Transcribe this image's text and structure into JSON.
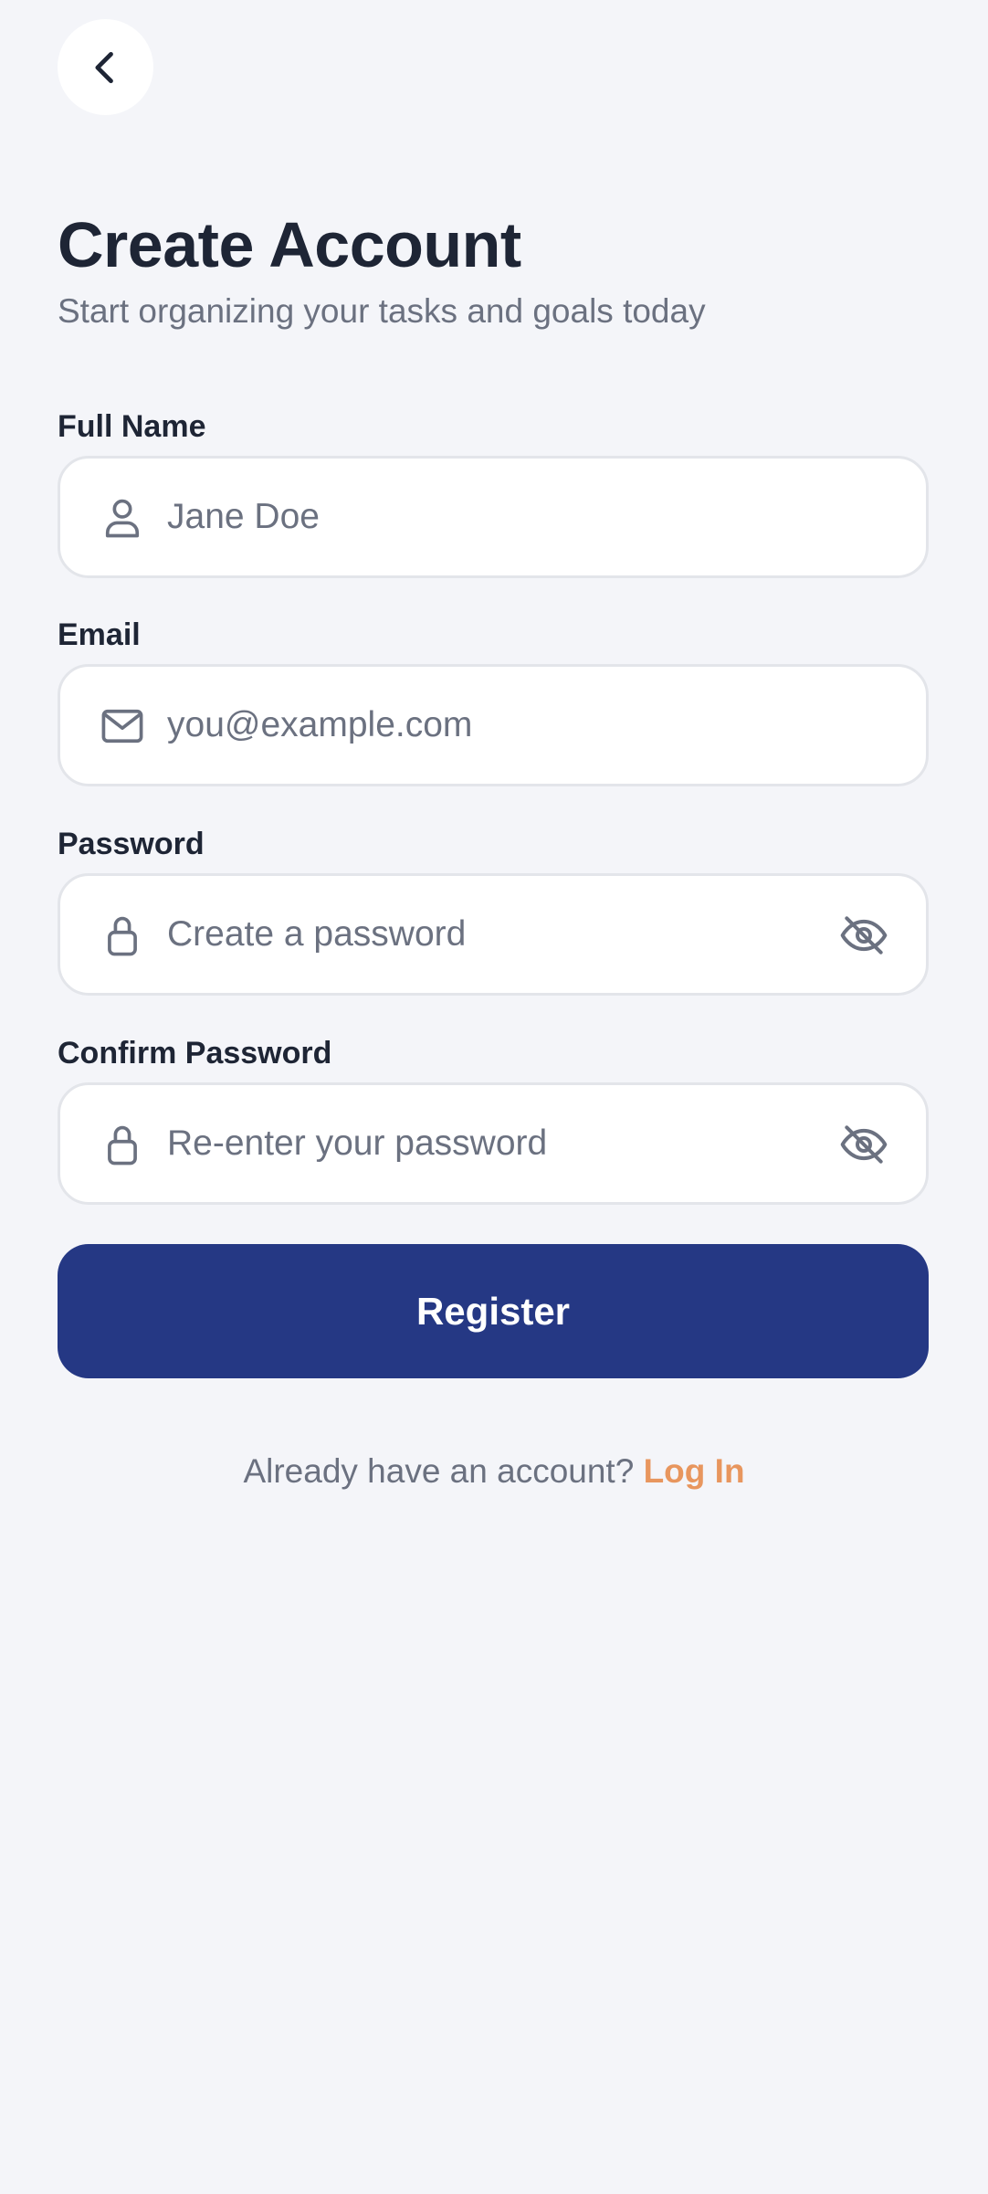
{
  "header": {
    "back_icon": "chevron-left-icon",
    "title": "Create Account",
    "subtitle": "Start organizing your tasks and goals today"
  },
  "form": {
    "full_name": {
      "label": "Full Name",
      "placeholder": "Jane Doe",
      "value": "",
      "icon": "user-icon"
    },
    "email": {
      "label": "Email",
      "placeholder": "you@example.com",
      "value": "",
      "icon": "mail-icon"
    },
    "password": {
      "label": "Password",
      "placeholder": "Create a password",
      "value": "",
      "icon": "lock-icon",
      "toggle_icon": "eye-off-icon"
    },
    "confirm_password": {
      "label": "Confirm Password",
      "placeholder": "Re-enter your password",
      "value": "",
      "icon": "lock-icon",
      "toggle_icon": "eye-off-icon"
    },
    "register_label": "Register"
  },
  "footer": {
    "prompt": "Already have an account?",
    "login_label": "Log In"
  },
  "colors": {
    "background": "#f4f5f9",
    "primary": "#253884",
    "accent": "#e8965e",
    "text_dark": "#1e2535",
    "text_muted": "#6b7180",
    "field_border": "#e3e5ea"
  }
}
